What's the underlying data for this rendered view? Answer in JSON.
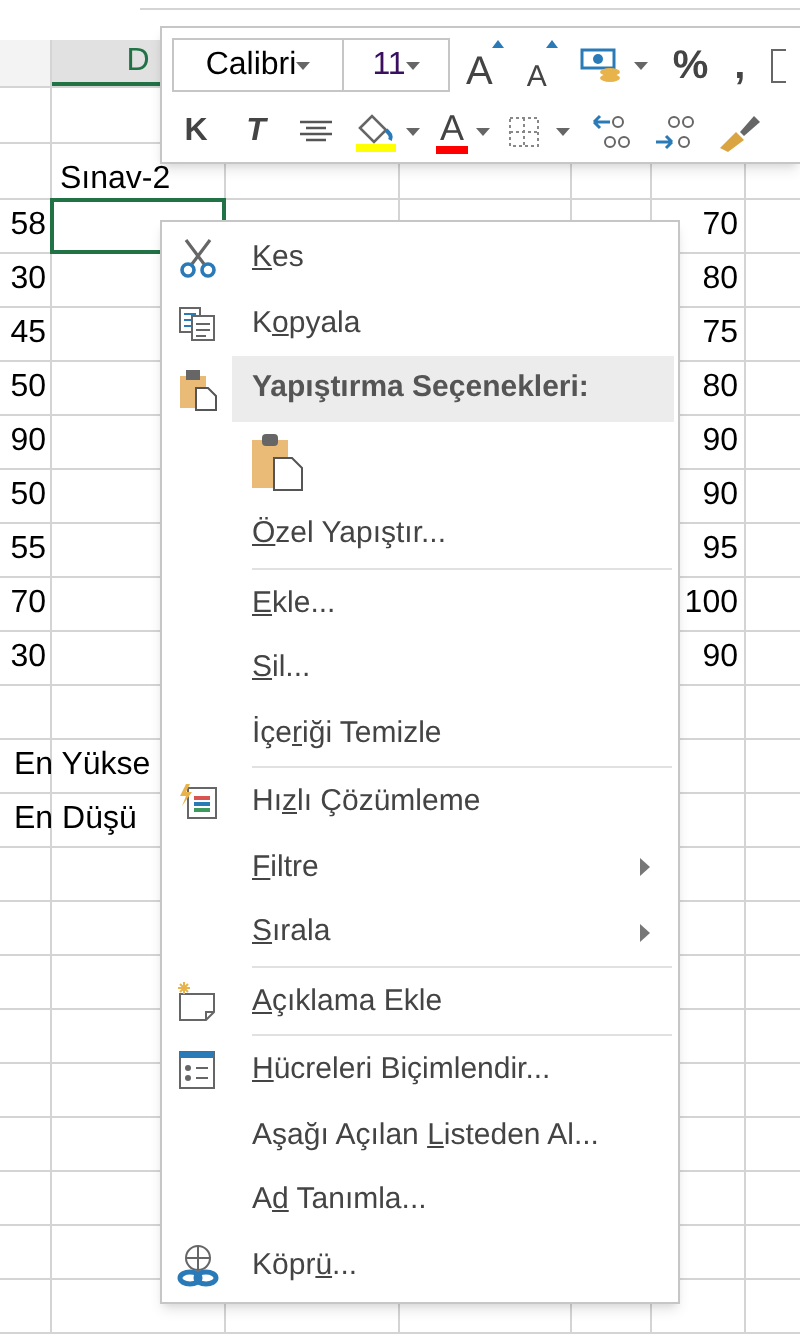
{
  "columns": [
    {
      "label": "D",
      "selected": true
    }
  ],
  "header_row": [
    "Sınav-2"
  ],
  "rows": [
    {
      "column_1": "58",
      "column_2": "70"
    },
    {
      "column_1": "30",
      "column_2": "80"
    },
    {
      "column_1": "45",
      "column_2": "75"
    },
    {
      "column_1": "50",
      "column_2": "80"
    },
    {
      "column_1": "90",
      "column_2": "90"
    },
    {
      "column_1": "50",
      "column_2": "90"
    },
    {
      "column_1": "55",
      "column_2": "95"
    },
    {
      "column_1": "70",
      "column_2": "100"
    },
    {
      "column_1": "30",
      "column_2": "90"
    }
  ],
  "summary_rows": [
    "En Yükse",
    "En Düşü"
  ],
  "toolbar": {
    "font": "Calibri",
    "size": "11",
    "row_1": [
      {
        "kind": "grow",
        "text": "A"
      },
      {
        "kind": "shrink",
        "text": "A"
      },
      {
        "kind": "accounting"
      },
      {
        "kind": "char",
        "text": "%"
      },
      {
        "kind": "char",
        "text": ","
      },
      {
        "kind": "cut"
      }
    ],
    "row_2": [
      {
        "kind": "bold",
        "text": "K"
      },
      {
        "kind": "italic",
        "text": "T"
      },
      {
        "kind": "align"
      },
      {
        "kind": "fill"
      },
      {
        "kind": "fontcolor",
        "text": "A"
      },
      {
        "kind": "borders"
      },
      {
        "kind": "incdec"
      },
      {
        "kind": "decdec"
      },
      {
        "kind": "painter"
      }
    ]
  },
  "menu": [
    {
      "kind": "item",
      "key": "K",
      "after": "es"
    },
    {
      "kind": "item",
      "before": "K",
      "key": "o",
      "after": "pyala"
    },
    {
      "kind": "header",
      "text": "Yapıştırma Seçenekleri:"
    },
    {
      "kind": "paste_option"
    },
    {
      "kind": "item",
      "key": "Ö",
      "after": "zel Yapıştır..."
    },
    {
      "kind": "separator"
    },
    {
      "kind": "item",
      "key": "E",
      "after": "kle..."
    },
    {
      "kind": "item",
      "key": "S",
      "after": "il..."
    },
    {
      "kind": "item",
      "before": "İçe",
      "key": "r",
      "after": "iği Temizle"
    },
    {
      "kind": "separator"
    },
    {
      "kind": "item",
      "before": "Hı",
      "key": "z",
      "after": "lı Çözümleme"
    },
    {
      "kind": "item",
      "key": "F",
      "after": "iltre",
      "submenu": true
    },
    {
      "kind": "item",
      "key": "S",
      "after": "ırala",
      "submenu": true
    },
    {
      "kind": "separator"
    },
    {
      "kind": "item",
      "key": "A",
      "after": "çıklama Ekle"
    },
    {
      "kind": "separator"
    },
    {
      "kind": "item",
      "key": "H",
      "after": "ücreleri Biçimlendir..."
    },
    {
      "kind": "item",
      "before": "Aşağı Açılan ",
      "key": "L",
      "after": "isteden Al..."
    },
    {
      "kind": "item",
      "before": "A",
      "key": "d",
      "after": " Tanımla..."
    },
    {
      "kind": "item",
      "before": "Köpr",
      "key": "ü",
      "after": "..."
    }
  ]
}
